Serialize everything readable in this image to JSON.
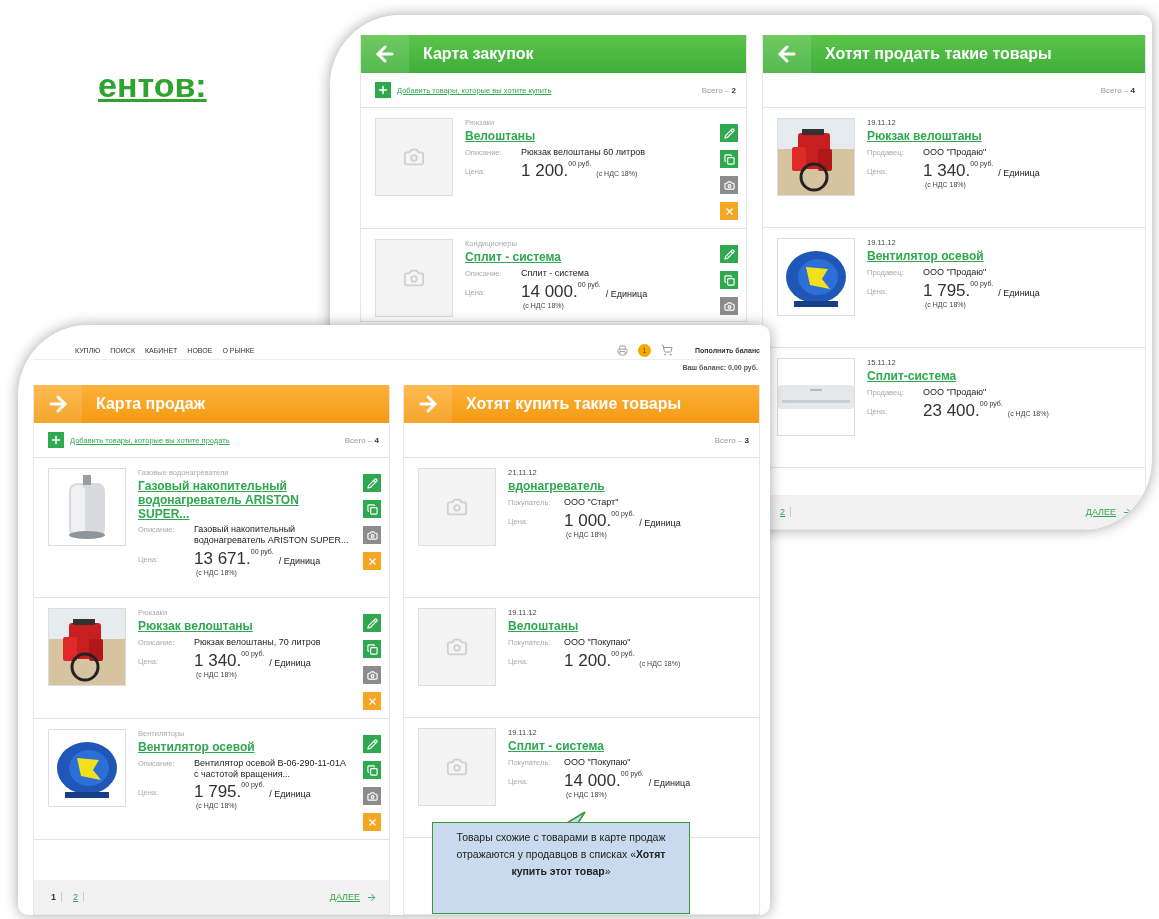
{
  "slide_title": "ентов:",
  "back_card": {
    "kind": "purchases",
    "panels": [
      {
        "title": "Карта закупок",
        "add_link": "Добавить товары, которые вы хотите купить",
        "total": "Всего – **2**",
        "items": [
          {
            "top": "Рюкзаки",
            "title": "Велоштаны",
            "kind": "placeholder",
            "fields": [
              {
                "label": "Описание:",
                "value": "Рюкзак велоштаны 60 литров"
              }
            ],
            "price_label": "Цена:",
            "price": {
              "main": "1 200.",
              "cents": "00 руб.",
              "vat": "(с НДС 18%)"
            }
          },
          {
            "top": "Кондиционеры",
            "title": "Сплит - система",
            "kind": "placeholder",
            "fields": [
              {
                "label": "Описание:",
                "value": "Сплит - система"
              }
            ],
            "price_label": "Цена:",
            "price": {
              "main": "14 000.",
              "cents": "00 руб.",
              "unit": "/ Единица",
              "vat": "(с НДС 18%)"
            }
          }
        ]
      },
      {
        "title": "Хотят продать такие товары",
        "total": "Всего – **4**",
        "items": [
          {
            "date": "19.11.12",
            "title": "Рюкзак велоштаны",
            "kind": "picture",
            "fields": [
              {
                "label": "Продавец:",
                "value": "ООО \"Продаю\""
              }
            ],
            "price_label": "Цена:",
            "price": {
              "main": "1 340.",
              "cents": "00 руб.",
              "unit": "/ Единица",
              "vat": "(с НДС 18%)"
            }
          },
          {
            "date": "19.11.12",
            "title": "Вентилятор осевой",
            "kind": "picture",
            "fields": [
              {
                "label": "Продавец:",
                "value": "ООО \"Продаю\""
              }
            ],
            "price_label": "Цена:",
            "price": {
              "main": "1 795.",
              "cents": "00 руб.",
              "unit": "/ Единица",
              "vat": "(с НДС 18%)"
            }
          },
          {
            "date": "15.11.12",
            "title": "Сплит-система",
            "kind": "picture",
            "fields": [
              {
                "label": "Продавец:",
                "value": "ООО \"Продаю\""
              }
            ],
            "price_label": "Цена:",
            "price": {
              "main": "23 400.",
              "cents": "00 руб.",
              "vat": "(с НДС 18%)"
            }
          }
        ],
        "footer": {
          "pages": [
            {
              "label": "2",
              "selected": false
            }
          ],
          "next": "ДАЛЕЕ"
        }
      }
    ]
  },
  "front_card": {
    "kind": "sales",
    "nav": [
      "КУПЛЮ",
      "ПОИСК",
      "КАБИНЕТ",
      "НОВОЕ",
      "О РЫНКЕ"
    ],
    "badge": "1",
    "top_up": "Пополнить баланс",
    "balance": "Ваш баланс: 0,00 руб.",
    "panels": [
      {
        "title": "Карта продаж",
        "add_link": "Добавить товары, которые вы хотите продать",
        "total": "Всего – **4**",
        "items": [
          {
            "top": "Газовые водонагреватели",
            "title": "Газовый накопительный водонагреватель ARISTON SUPER...",
            "kind": "picture",
            "fields": [
              {
                "label": "Описание:",
                "value": "Газовый накопительный водонагреватель ARISTON SUPER..."
              }
            ],
            "price_label": "Цена:",
            "price": {
              "main": "13 671.",
              "cents": "00 руб.",
              "unit": "/ Единица",
              "vat": "(с НДС 18%)"
            }
          },
          {
            "top": "Рюкзаки",
            "title": "Рюкзак велоштаны",
            "kind": "picture",
            "fields": [
              {
                "label": "Описание:",
                "value": "Рюкзак велоштаны, 70 литров"
              }
            ],
            "price_label": "Цена:",
            "price": {
              "main": "1 340.",
              "cents": "00 руб.",
              "unit": "/ Единица",
              "vat": "(с НДС 18%)"
            }
          },
          {
            "top": "Вентиляторы",
            "title": "Вентилятор осевой",
            "kind": "picture",
            "fields": [
              {
                "label": "Описание:",
                "value": "Вентилятор осевой В-06-290-11-01А с частотой вращения..."
              }
            ],
            "price_label": "Цена:",
            "price": {
              "main": "1 795.",
              "cents": "00 руб.",
              "unit": "/ Единица",
              "vat": "(с НДС 18%)"
            }
          }
        ],
        "footer": {
          "pages": [
            {
              "label": "1",
              "selected": true
            },
            {
              "label": "2",
              "selected": false
            }
          ],
          "next": "ДАЛЕЕ"
        }
      },
      {
        "title": "Хотят купить такие товары",
        "total": "Всего – **3**",
        "items": [
          {
            "date": "21.11.12",
            "title": "вдонагреватель",
            "kind": "placeholder",
            "fields": [
              {
                "label": "Покупатель:",
                "value": "ООО \"Старт\""
              }
            ],
            "price_label": "Цена:",
            "price": {
              "main": "1 000.",
              "cents": "00 руб.",
              "unit": "/ Единица",
              "vat": "(с НДС 18%)"
            }
          },
          {
            "date": "19.11.12",
            "title": "Велоштаны",
            "kind": "placeholder",
            "fields": [
              {
                "label": "Покупатель:",
                "value": "ООО \"Покупаю\""
              }
            ],
            "price_label": "Цена:",
            "price": {
              "main": "1 200.",
              "cents": "00 руб.",
              "vat": "(с НДС 18%)"
            }
          },
          {
            "date": "19.11.12",
            "title": "Сплит - система",
            "kind": "placeholder",
            "fields": [
              {
                "label": "Покупатель:",
                "value": "ООО \"Покупаю\""
              }
            ],
            "price_label": "Цена:",
            "price": {
              "main": "14 000.",
              "cents": "00 руб.",
              "unit": "/ Единица",
              "vat": "(с НДС 18%)"
            }
          }
        ]
      }
    ],
    "callout": "Товары схожие с товарами в карте продаж отражаются у продавцов в списках «**Хотят купить этот товар**»"
  }
}
